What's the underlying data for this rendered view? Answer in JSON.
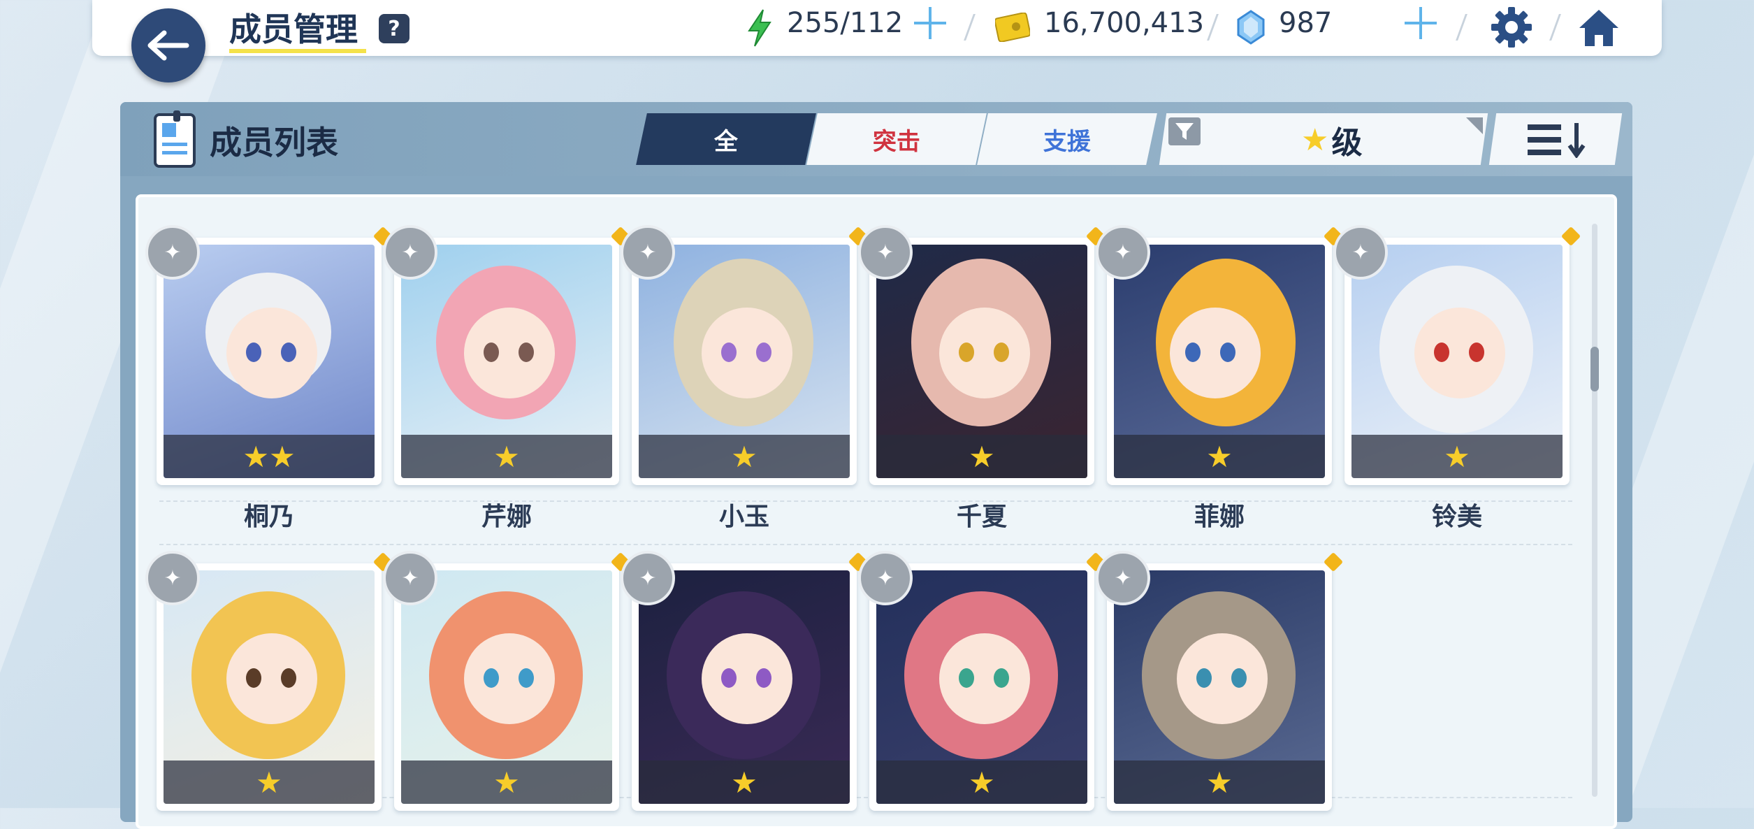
{
  "header": {
    "title": "成员管理",
    "help_icon": "?",
    "stamina": "255/112",
    "credits": "16,700,413",
    "gems": "987"
  },
  "panel": {
    "title": "成员列表",
    "tabs": [
      {
        "label": "全",
        "active": true
      },
      {
        "label": "突击",
        "active": false
      },
      {
        "label": "支援",
        "active": false
      }
    ],
    "filter": {
      "star": "★",
      "label": "级"
    }
  },
  "members": [
    {
      "name": "桐乃",
      "stars": "★★"
    },
    {
      "name": "芹娜",
      "stars": "★"
    },
    {
      "name": "小玉",
      "stars": "★"
    },
    {
      "name": "千夏",
      "stars": "★"
    },
    {
      "name": "菲娜",
      "stars": "★"
    },
    {
      "name": "铃美",
      "stars": "★"
    },
    {
      "name": "",
      "stars": "★"
    },
    {
      "name": "",
      "stars": "★"
    },
    {
      "name": "",
      "stars": "★"
    },
    {
      "name": "",
      "stars": "★"
    },
    {
      "name": "",
      "stars": "★"
    }
  ],
  "colors": {
    "accent_dark": "#233a5e",
    "attack": "#d0333f",
    "support": "#3f73d8",
    "star": "#f7cd2a",
    "stamina": "#3cbf52",
    "credit": "#f1c922",
    "gem": "#5aa6ec"
  },
  "icons": [
    "back-arrow-icon",
    "help-icon",
    "lightning-icon",
    "credit-card-icon",
    "gem-icon",
    "plus-icon",
    "gear-icon",
    "home-icon",
    "member-list-icon",
    "filter-icon",
    "sort-icon",
    "pin-icon",
    "star-icon"
  ]
}
